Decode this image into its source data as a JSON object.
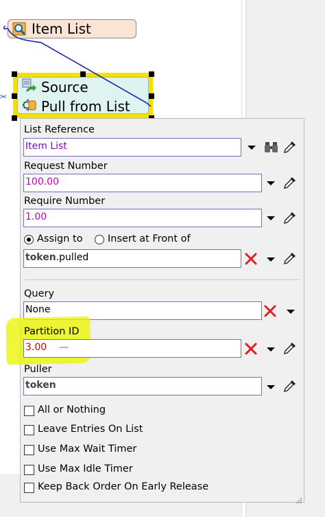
{
  "canvas": {
    "item_list_node": {
      "label": "Item List",
      "icon": "list-magnify-icon"
    },
    "selected_node": {
      "rows": [
        {
          "label": "Source",
          "icon": "source-icon"
        },
        {
          "label": "Pull from List",
          "icon": "pull-from-list-icon"
        }
      ]
    },
    "connector_color": "#1a2bb0",
    "selection_color": "#f7df00"
  },
  "panel": {
    "list_reference": {
      "label": "List Reference",
      "value": "Item List"
    },
    "request_number": {
      "label": "Request Number",
      "value": "100.00"
    },
    "require_number": {
      "label": "Require Number",
      "value": "1.00"
    },
    "assign_mode": {
      "options": [
        {
          "label": "Assign to",
          "selected": true
        },
        {
          "label": "Insert at Front of",
          "selected": false
        }
      ]
    },
    "assign_target": {
      "token_prefix": "token",
      "suffix": ".pulled"
    },
    "query": {
      "label": "Query",
      "value": "None"
    },
    "partition_id": {
      "label": "Partition ID",
      "value": "3.00",
      "trailing": "—"
    },
    "puller": {
      "label": "Puller",
      "value": "token"
    },
    "checkboxes": [
      {
        "label": "All or Nothing",
        "checked": false
      },
      {
        "label": "Leave Entries On List",
        "checked": false
      },
      {
        "label": "Use Max Wait Timer",
        "checked": false
      },
      {
        "label": "Use Max Idle Timer",
        "checked": false
      },
      {
        "label": "Keep Back Order On Early Release",
        "checked": false
      }
    ],
    "colors": {
      "purple": "#7c0cb8",
      "magenta": "#c000c0",
      "red": "#d00000",
      "highlight": "#ebf500"
    }
  }
}
